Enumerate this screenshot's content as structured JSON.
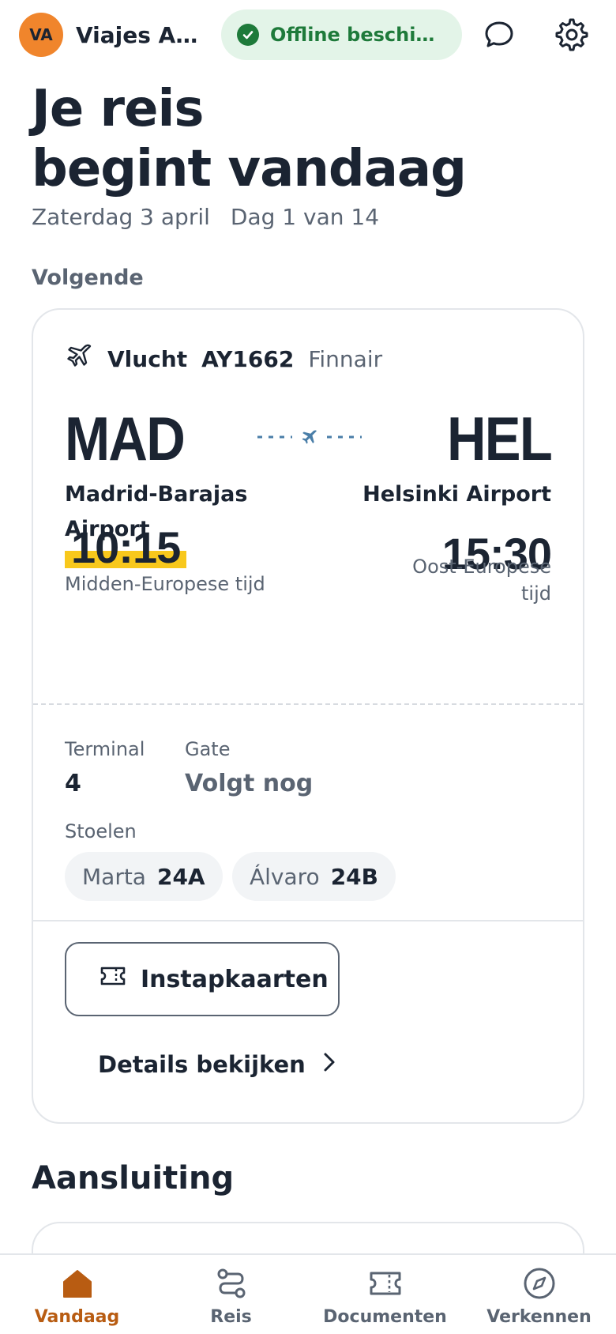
{
  "header": {
    "avatar_initials": "VA",
    "agency_name": "Viajes Au...",
    "offline_status": "Offline beschikb...",
    "chat_icon": "chat-bubble-icon",
    "settings_icon": "gear-icon"
  },
  "hero": {
    "title_line1": "Je reis",
    "title_line2": "begint vandaag",
    "date": "Zaterdag 3 april",
    "day_progress": "Dag 1 van 14"
  },
  "next_section": {
    "label": "Volgende",
    "flight": {
      "type_label": "Vlucht",
      "number": "AY1662",
      "airline": "Finnair",
      "departure": {
        "code": "MAD",
        "airport": "Madrid-Barajas Airport",
        "time": "10:15",
        "timezone": "Midden-Europese tijd"
      },
      "arrival": {
        "code": "HEL",
        "airport": "Helsinki Airport",
        "time": "15:30",
        "timezone": "Oost-Europese tijd"
      },
      "terminal_label": "Terminal",
      "terminal_value": "4",
      "gate_label": "Gate",
      "gate_value": "Volgt nog",
      "seats_label": "Stoelen",
      "seats": [
        {
          "name": "Marta",
          "seat": "24A"
        },
        {
          "name": "Álvaro",
          "seat": "24B"
        }
      ],
      "boarding_button": "Instapkaarten",
      "details_link": "Details bekijken"
    }
  },
  "connection_section": {
    "title": "Aansluiting"
  },
  "bottom_nav": {
    "items": [
      {
        "label": "Vandaag",
        "icon": "home-icon",
        "active": true
      },
      {
        "label": "Reis",
        "icon": "route-icon",
        "active": false
      },
      {
        "label": "Documenten",
        "icon": "ticket-icon",
        "active": false
      },
      {
        "label": "Verkennen",
        "icon": "compass-icon",
        "active": false
      }
    ]
  },
  "colors": {
    "accent_orange": "#f0852c",
    "offline_green": "#1e7a3a",
    "offline_bg": "#e3f4e8",
    "highlight_yellow": "#f8c81c",
    "nav_active": "#b85c12",
    "text_dark": "#1b2432",
    "text_muted": "#5a6472"
  }
}
